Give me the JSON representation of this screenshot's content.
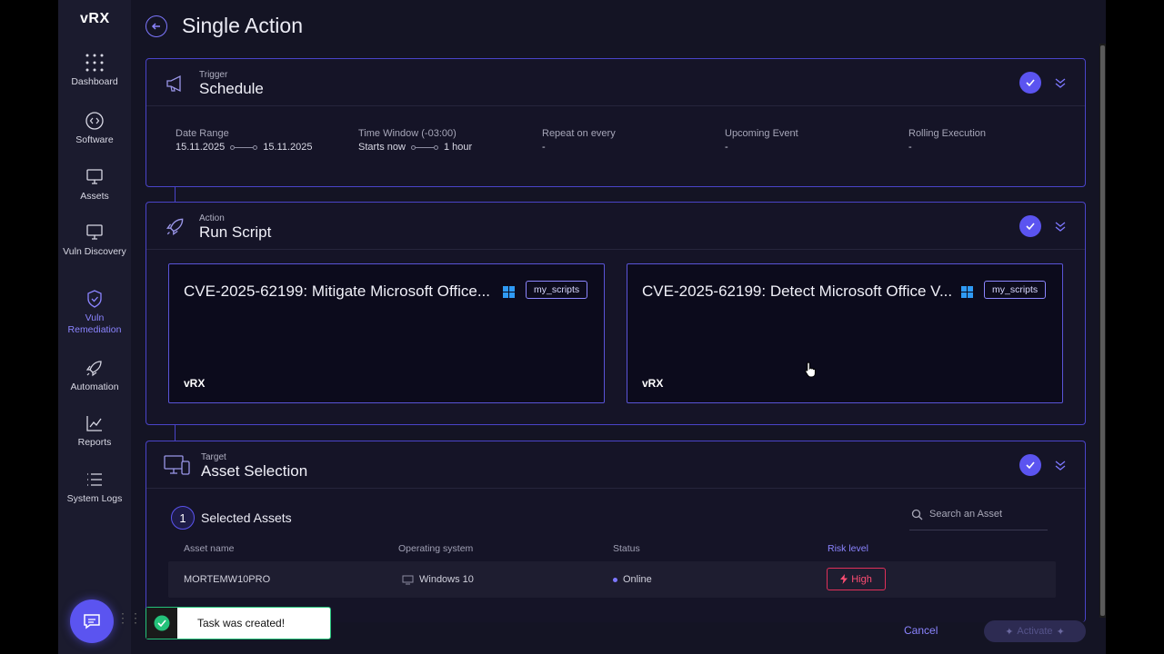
{
  "sidebar": {
    "logo": "vRX",
    "items": [
      {
        "label": "Dashboard",
        "icon": "dots-grid-icon"
      },
      {
        "label": "Software",
        "icon": "code-icon"
      },
      {
        "label": "Assets",
        "icon": "monitor-icon"
      },
      {
        "label": "Vuln Discovery",
        "icon": "monitor-search-icon"
      },
      {
        "label": "Vuln Remediation",
        "icon": "shield-icon"
      },
      {
        "label": "Automation",
        "icon": "rocket-icon"
      },
      {
        "label": "Reports",
        "icon": "report-icon"
      },
      {
        "label": "System Logs",
        "icon": "list-icon"
      }
    ],
    "active": "Vuln Remediation"
  },
  "header": {
    "title": "Single Action"
  },
  "trigger": {
    "kicker": "Trigger",
    "title": "Schedule",
    "date_range_label": "Date Range",
    "date_from": "15.11.2025",
    "date_to": "15.11.2025",
    "time_window_label": "Time Window (-03:00)",
    "time_start": "Starts now",
    "time_end": "1 hour",
    "repeat_label": "Repeat on every",
    "repeat_value": "-",
    "upcoming_label": "Upcoming Event",
    "upcoming_value": "-",
    "rolling_label": "Rolling Execution",
    "rolling_value": "-"
  },
  "action": {
    "kicker": "Action",
    "title": "Run Script",
    "scripts": [
      {
        "title": "CVE-2025-62199: Mitigate Microsoft Office...",
        "tag": "my_scripts",
        "logo": "vRX"
      },
      {
        "title": "CVE-2025-62199: Detect Microsoft Office V...",
        "tag": "my_scripts",
        "logo": "vRX"
      }
    ]
  },
  "target": {
    "kicker": "Target",
    "title": "Asset Selection",
    "selected_count": "1",
    "selected_label": "Selected Assets",
    "search_placeholder": "Search an Asset",
    "columns": [
      "Asset name",
      "Operating system",
      "Status",
      "Risk level"
    ],
    "rows": [
      {
        "asset": "MORTEMW10PRO",
        "os": "Windows 10",
        "status": "Online",
        "risk": "High"
      }
    ]
  },
  "toast": {
    "text": "Task was created!"
  },
  "footer": {
    "cancel": "Cancel",
    "activate": "Activate"
  },
  "colors": {
    "accent": "#5b54f0",
    "risk_high": "#ff4d73",
    "success": "#24c27a"
  }
}
